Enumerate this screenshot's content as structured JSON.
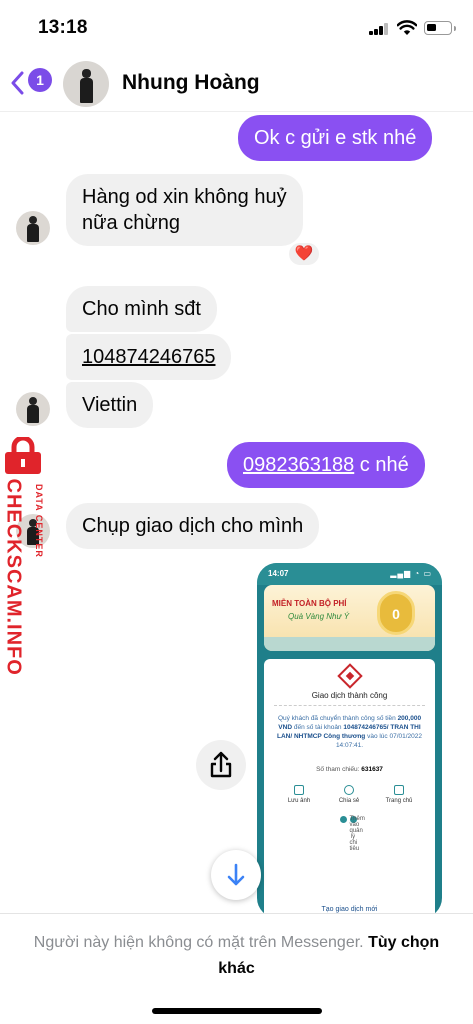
{
  "status_bar": {
    "time": "13:18"
  },
  "header": {
    "back_badge": "1",
    "contact_name": "Nhung Hoàng"
  },
  "messages": [
    {
      "from": "me",
      "text": "Ok c gửi e stk nhé"
    },
    {
      "from": "them",
      "text": "Hàng od xin không huỷ nữa chừng",
      "line1": "Hàng od xin không huỷ",
      "line2": "nữa chừng",
      "reaction": "❤️"
    },
    {
      "from": "them",
      "text": "Cho mình sđt"
    },
    {
      "from": "them",
      "text": "104874246765"
    },
    {
      "from": "them",
      "text": "Viettin"
    },
    {
      "from": "me",
      "phone": "0982363188",
      "text": " c nhé"
    },
    {
      "from": "them",
      "text": "Chụp giao dịch cho mình"
    }
  ],
  "watermark": {
    "main": "CHECKSCAM.INFO",
    "sub": "DATA CENTER"
  },
  "screenshot": {
    "time": "14:07",
    "banner_title": "MIỄN TOÀN BỘ PHÍ",
    "banner_sub": "Quà Vàng Như Ý",
    "coin": "0",
    "status": "Giao dịch thành công",
    "desc_1": "Quý khách đã chuyển thành công số tiền",
    "amount": "200,000 VND",
    "desc_2": "đến số tài khoản",
    "account": "104874246765/ TRAN THI LAN/ NHTMCP Công thương",
    "desc_3": "vào lúc 07/01/2022 14:07:41.",
    "ref_label": "Số tham chiếu:",
    "ref_value": "631637",
    "actions": [
      "Lưu ảnh",
      "Chia sẻ",
      "Trang chủ"
    ],
    "add_manage": "Thêm vào quản lý chi tiêu",
    "options": [
      "Lưu mẫu chuyển tiền",
      "Gửi email thông báo giao dịch"
    ],
    "new_tx": "Tạo giao dịch mới"
  },
  "footer": {
    "notice": "Người này hiện không có mặt trên Messenger.",
    "more": "Tùy chọn khác"
  },
  "colors": {
    "accent": "#8a50f2",
    "incoming": "#f0f0f0",
    "watermark": "#e0242b"
  }
}
